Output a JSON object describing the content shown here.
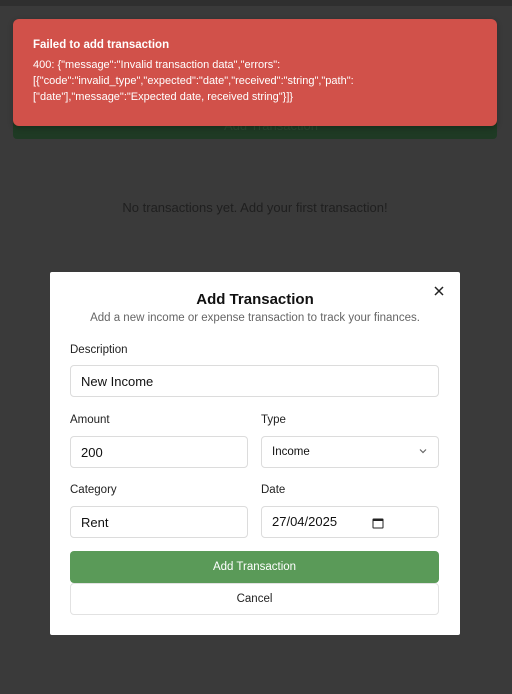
{
  "background": {
    "add_button_label": "Add Transaction",
    "empty_message": "No transactions yet. Add your first transaction!"
  },
  "toast": {
    "title": "Failed to add transaction",
    "message": "400: {\"message\":\"Invalid transaction data\",\"errors\":\n[{\"code\":\"invalid_type\",\"expected\":\"date\",\"received\":\"string\",\"path\":\n[\"date\"],\"message\":\"Expected date, received string\"}]}"
  },
  "modal": {
    "title": "Add Transaction",
    "subtitle": "Add a new income or expense transaction to track your finances.",
    "close_icon": "close-icon",
    "fields": {
      "description": {
        "label": "Description",
        "value": "New Income"
      },
      "amount": {
        "label": "Amount",
        "value": "200"
      },
      "type": {
        "label": "Type",
        "value": "Income"
      },
      "category": {
        "label": "Category",
        "value": "Rent"
      },
      "date": {
        "label": "Date",
        "value": "27/04/2025"
      }
    },
    "submit_label": "Add Transaction",
    "cancel_label": "Cancel"
  },
  "colors": {
    "toast_bg": "#d1514a",
    "primary": "#5a9a58",
    "overlay": "#3b3b3b"
  }
}
